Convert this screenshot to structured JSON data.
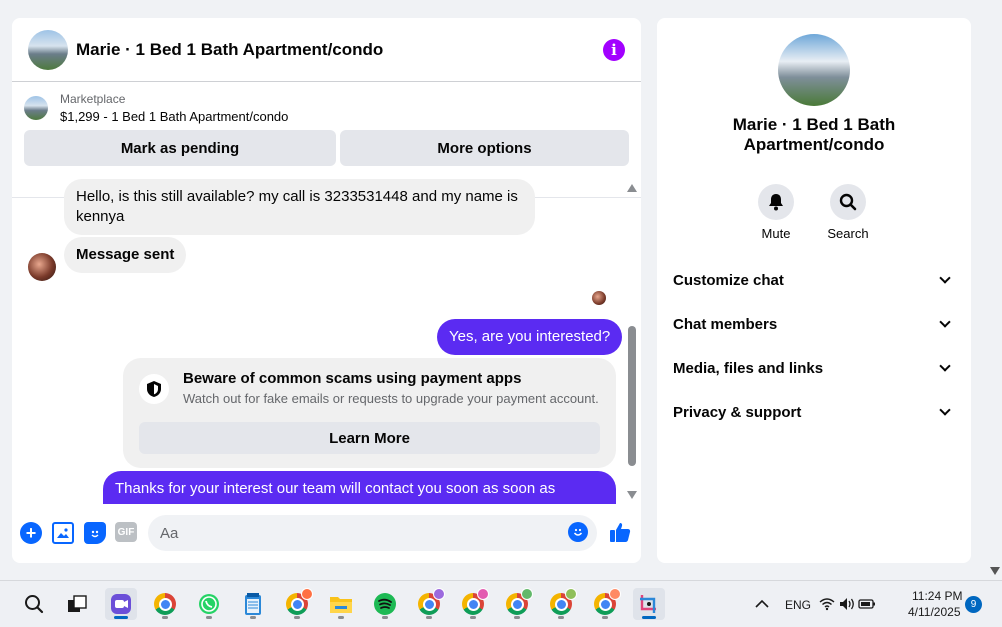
{
  "chat": {
    "title": "Marie · 1 Bed 1 Bath Apartment/condo",
    "marketplace_label": "Marketplace",
    "listing": "$1,299 - 1 Bed 1 Bath Apartment/condo",
    "mark_pending": "Mark as pending",
    "more_options": "More options",
    "messages": [
      {
        "from": "them",
        "text": "Hello, is this still available? my call is 3233531448 and my name is kennya"
      },
      {
        "from": "them",
        "text": "Message sent"
      },
      {
        "from": "me",
        "text": "Yes, are you interested?"
      },
      {
        "from": "me",
        "text": "Thanks for your interest our team will contact you soon as soon as"
      }
    ],
    "warning": {
      "title": "Beware of common scams using payment apps",
      "subtitle": "Watch out for fake emails or requests to upgrade your payment account.",
      "button": "Learn More"
    },
    "composer_placeholder": "Aa",
    "gif_label": "GIF"
  },
  "info_panel": {
    "title": "Marie · 1 Bed 1 Bath Apartment/condo",
    "actions": [
      {
        "label": "Mute",
        "icon": "bell-icon"
      },
      {
        "label": "Search",
        "icon": "search-icon"
      }
    ],
    "sections": [
      "Customize chat",
      "Chat members",
      "Media, files and links",
      "Privacy & support"
    ]
  },
  "taskbar": {
    "language": "ENG",
    "time": "11:24 PM",
    "date": "4/11/2025",
    "notification_count": "9"
  },
  "colors": {
    "accent_blue": "#0866ff",
    "outgoing_bubble": "#5b2bf2",
    "info_icon": "#a200ff"
  }
}
